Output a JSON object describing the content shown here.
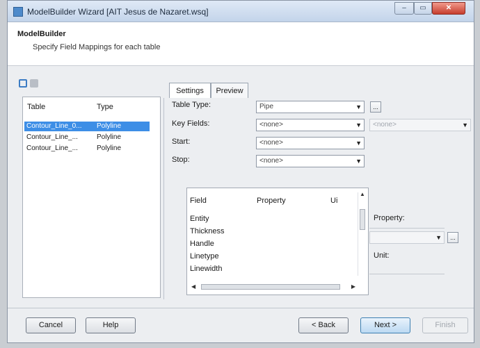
{
  "window": {
    "title": "ModelBuilder Wizard [AIT Jesus de Nazaret.wsq]",
    "controls": {
      "minimize": "–",
      "maximize": "▭",
      "close": "✕"
    }
  },
  "header": {
    "title": "ModelBuilder",
    "subtitle": "Specify Field Mappings for each table"
  },
  "toolbar": {
    "icons": [
      "select-all-icon",
      "delete-icon"
    ]
  },
  "tables_panel": {
    "columns": {
      "table": "Table",
      "type": "Type"
    },
    "rows": [
      {
        "table": "Contour_Line_0...",
        "type": "Polyline",
        "selected": true
      },
      {
        "table": "Contour_Line_...",
        "type": "Polyline",
        "selected": false
      },
      {
        "table": "Contour_Line_...",
        "type": "Polyline",
        "selected": false
      }
    ]
  },
  "tabs": [
    {
      "label": "Settings",
      "active": true
    },
    {
      "label": "Preview",
      "active": false
    }
  ],
  "settings": {
    "table_type_label": "Table Type:",
    "table_type_value": "Pipe",
    "key_fields_label": "Key Fields:",
    "key_fields_value": "<none>",
    "key_fields_right_value": "<none>",
    "start_label": "Start:",
    "start_value": "<none>",
    "stop_label": "Stop:",
    "stop_value": "<none>",
    "browse_label": "..."
  },
  "field_list": {
    "columns": {
      "field": "Field",
      "property": "Property",
      "unit": "Ui"
    },
    "items": [
      "Entity",
      "Thickness",
      "Handle",
      "Linetype",
      "Linewidth"
    ]
  },
  "property_panel": {
    "property_label": "Property:",
    "unit_label": "Unit:",
    "browse_label": "..."
  },
  "footer": {
    "cancel": "Cancel",
    "help": "Help",
    "back": "< Back",
    "next": "Next >",
    "finish": "Finish"
  }
}
